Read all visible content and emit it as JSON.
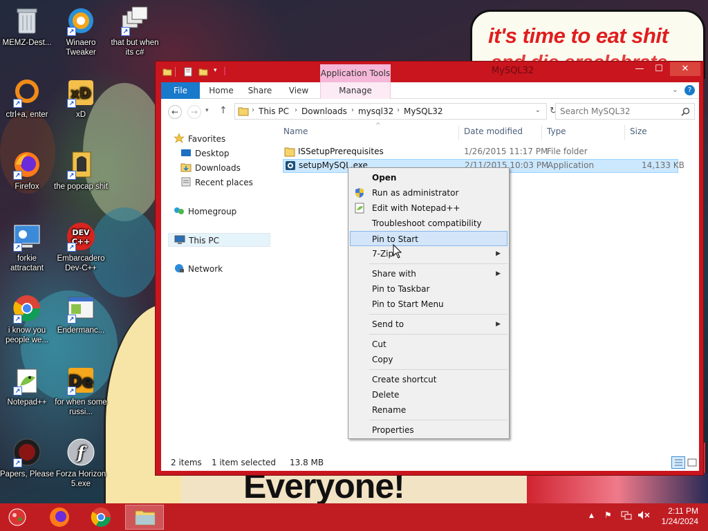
{
  "wallpaper": {
    "speech_text": "it's time to eat shit",
    "speech_text2": "and die eraclebrate",
    "banner_text": "Everyone!"
  },
  "desktop_icons": [
    {
      "label": "MEMZ-Dest...",
      "icon": "recycle-bin-icon"
    },
    {
      "label": "Winaero Tweaker",
      "icon": "winaero-icon"
    },
    {
      "label": "that but when its c#",
      "icon": "windows-stack-icon"
    },
    {
      "label": "ctrl+a, enter",
      "icon": "ring-icon"
    },
    {
      "label": "xD",
      "icon": "hxd-icon"
    },
    {
      "label": "Firefox",
      "icon": "firefox-icon"
    },
    {
      "label": "the popcap shit",
      "icon": "popcap-icon"
    },
    {
      "label": "forkie attractant",
      "icon": "control-panel-icon"
    },
    {
      "label": "Embarcadero Dev-C++",
      "icon": "devcpp-icon"
    },
    {
      "label": "i know you people we...",
      "icon": "chrome-icon"
    },
    {
      "label": "Endermanc...",
      "icon": "window-app-icon"
    },
    {
      "label": "Notepad++",
      "icon": "notepadpp-icon"
    },
    {
      "label": "for when some russi...",
      "icon": "de-icon"
    },
    {
      "label": "Papers, Please",
      "icon": "papers-please-icon"
    },
    {
      "label": "Forza Horizon 5.exe",
      "icon": "flash-icon"
    }
  ],
  "window": {
    "title": "MySQL32",
    "contextual_tab": "Application Tools",
    "tabs": [
      "File",
      "Home",
      "Share",
      "View"
    ],
    "manage_tab": "Manage",
    "breadcrumbs": [
      "This PC",
      "Downloads",
      "mysql32",
      "MySQL32"
    ],
    "search_placeholder": "Search MySQL32",
    "nav": {
      "favorites": "Favorites",
      "desktop": "Desktop",
      "downloads": "Downloads",
      "recent": "Recent places",
      "homegroup": "Homegroup",
      "thispc": "This PC",
      "network": "Network"
    },
    "columns": {
      "name": "Name",
      "date": "Date modified",
      "type": "Type",
      "size": "Size"
    },
    "files": [
      {
        "name": "ISSetupPrerequisites",
        "date": "1/26/2015 11:17 PM",
        "type": "File folder",
        "size": ""
      },
      {
        "name": "setupMySQL.exe",
        "date": "2/11/2015 10:03 PM",
        "type": "Application",
        "size": "14,133 KB"
      }
    ],
    "status": {
      "items": "2 items",
      "selected": "1 item selected",
      "size": "13.8 MB"
    }
  },
  "context_menu": {
    "open": "Open",
    "run_admin": "Run as administrator",
    "edit_npp": "Edit with Notepad++",
    "troubleshoot": "Troubleshoot compatibility",
    "pin_start": "Pin to Start",
    "zip": "7-Zip",
    "share_with": "Share with",
    "pin_taskbar": "Pin to Taskbar",
    "pin_start_menu": "Pin to Start Menu",
    "send_to": "Send to",
    "cut": "Cut",
    "copy": "Copy",
    "create_shortcut": "Create shortcut",
    "delete": "Delete",
    "rename": "Rename",
    "properties": "Properties"
  },
  "taskbar": {
    "time": "2:11 PM",
    "date": "1/24/2024"
  },
  "colors": {
    "window_frame": "#c9151e",
    "taskbar": "#c01d22",
    "accent_blue": "#1979ca",
    "selection": "#cce8ff"
  }
}
